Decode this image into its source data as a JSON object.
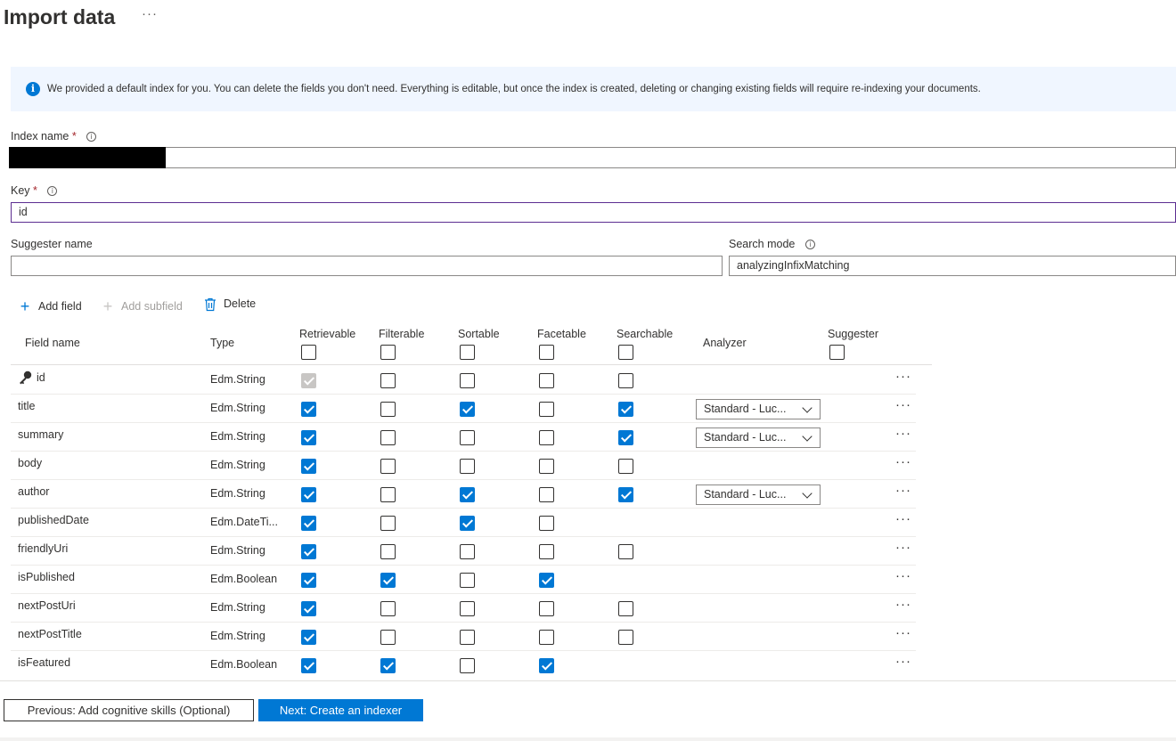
{
  "header": {
    "title": "Import data",
    "more": "···"
  },
  "info": {
    "text": "We provided a default index for you. You can delete the fields you don't need. Everything is editable, but once the index is created, deleting or changing existing fields will require re-indexing your documents."
  },
  "form": {
    "index_name_label": "Index name",
    "required_mark": "*",
    "key_label": "Key",
    "key_value": "id",
    "suggester_label": "Suggester name",
    "suggester_value": "",
    "search_mode_label": "Search mode",
    "search_mode_value": "analyzingInfixMatching"
  },
  "toolbar": {
    "add_field": "Add field",
    "add_subfield": "Add subfield",
    "delete": "Delete"
  },
  "columns": {
    "field_name": "Field name",
    "type": "Type",
    "retrievable": "Retrievable",
    "filterable": "Filterable",
    "sortable": "Sortable",
    "facetable": "Facetable",
    "searchable": "Searchable",
    "analyzer": "Analyzer",
    "suggester": "Suggester"
  },
  "rows": [
    {
      "name": "id",
      "type": "Edm.String",
      "retrievable": "locked",
      "filterable": false,
      "sortable": false,
      "facetable": false,
      "searchable": false,
      "analyzer": null,
      "is_key": true
    },
    {
      "name": "title",
      "type": "Edm.String",
      "retrievable": true,
      "filterable": false,
      "sortable": true,
      "facetable": false,
      "searchable": true,
      "analyzer": "Standard - Luc..."
    },
    {
      "name": "summary",
      "type": "Edm.String",
      "retrievable": true,
      "filterable": false,
      "sortable": false,
      "facetable": false,
      "searchable": true,
      "analyzer": "Standard - Luc..."
    },
    {
      "name": "body",
      "type": "Edm.String",
      "retrievable": true,
      "filterable": false,
      "sortable": false,
      "facetable": false,
      "searchable": false,
      "analyzer": null
    },
    {
      "name": "author",
      "type": "Edm.String",
      "retrievable": true,
      "filterable": false,
      "sortable": true,
      "facetable": false,
      "searchable": true,
      "analyzer": "Standard - Luc..."
    },
    {
      "name": "publishedDate",
      "type": "Edm.DateTi...",
      "retrievable": true,
      "filterable": false,
      "sortable": true,
      "facetable": false,
      "searchable": null,
      "analyzer": null
    },
    {
      "name": "friendlyUri",
      "type": "Edm.String",
      "retrievable": true,
      "filterable": false,
      "sortable": false,
      "facetable": false,
      "searchable": false,
      "analyzer": null
    },
    {
      "name": "isPublished",
      "type": "Edm.Boolean",
      "retrievable": true,
      "filterable": true,
      "sortable": false,
      "facetable": true,
      "searchable": null,
      "analyzer": null
    },
    {
      "name": "nextPostUri",
      "type": "Edm.String",
      "retrievable": true,
      "filterable": false,
      "sortable": false,
      "facetable": false,
      "searchable": false,
      "analyzer": null
    },
    {
      "name": "nextPostTitle",
      "type": "Edm.String",
      "retrievable": true,
      "filterable": false,
      "sortable": false,
      "facetable": false,
      "searchable": false,
      "analyzer": null
    },
    {
      "name": "isFeatured",
      "type": "Edm.Boolean",
      "retrievable": true,
      "filterable": true,
      "sortable": false,
      "facetable": true,
      "searchable": null,
      "analyzer": null
    }
  ],
  "row_more": "···",
  "footer": {
    "previous": "Previous: Add cognitive skills (Optional)",
    "next": "Next: Create an indexer"
  },
  "colors": {
    "accent": "#0078d4",
    "required": "#a4262c",
    "info_bg": "#f0f6ff"
  },
  "icons": [
    "info-icon",
    "plus-icon",
    "trash-icon",
    "key-icon",
    "chevron-down-icon",
    "more-icon"
  ]
}
